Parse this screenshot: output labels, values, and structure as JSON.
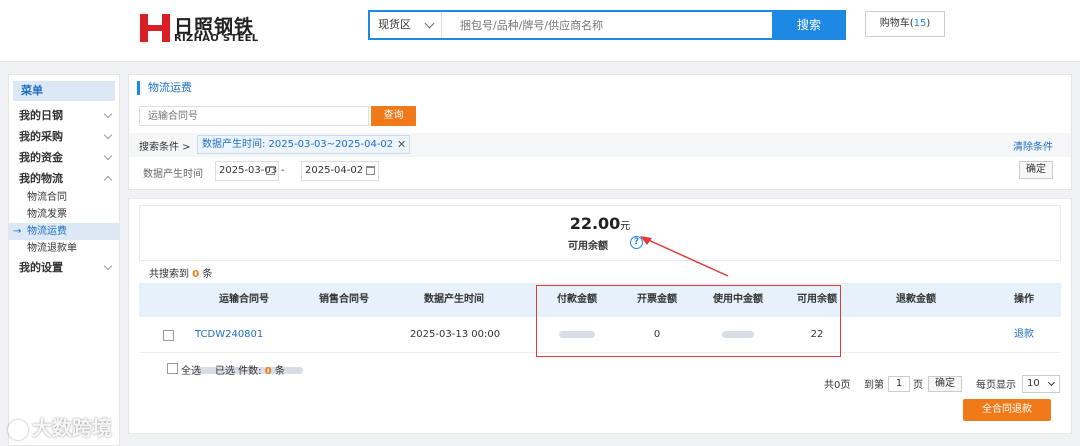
{
  "header": {
    "logo_cn": "日照钢铁",
    "logo_en": "RIZHAO STEEL",
    "search_scope": "现货区",
    "search_placeholder": "捆包号/品种/牌号/供应商名称",
    "search_button": "搜索",
    "cart_label": "购物车(",
    "cart_count": "15",
    "cart_suffix": ")"
  },
  "sidebar": {
    "title": "菜单",
    "groups": [
      {
        "label": "我的日钢"
      },
      {
        "label": "我的采购"
      },
      {
        "label": "我的资金"
      },
      {
        "label": "我的物流"
      }
    ],
    "sub_items": [
      {
        "label": "物流合同"
      },
      {
        "label": "物流发票"
      },
      {
        "label": "物流运费"
      },
      {
        "label": "物流退款单"
      }
    ],
    "last_group": "我的设置",
    "active_marker": "→"
  },
  "main": {
    "page_title": "物流运费",
    "contract_placeholder": "运输合同号",
    "query_button": "查询",
    "condition_label": "搜索条件 >",
    "condition_tag": "数据产生时间: 2025-03-03~2025-04-02",
    "condition_close": "✕",
    "clear_conditions": "清除条件",
    "date_label": "数据产生时间",
    "date_start": "2025-03-03",
    "date_end": "2025-04-02",
    "date_dash": "-",
    "confirm_button": "确定"
  },
  "balance": {
    "amount": "22.00",
    "unit": "元",
    "label": "可用余额",
    "help": "?"
  },
  "results": {
    "prefix": "共搜索到",
    "count": "0",
    "suffix": "条"
  },
  "table": {
    "headers": [
      "运输合同号",
      "销售合同号",
      "数据产生时间",
      "付款金额",
      "开票金额",
      "使用中金额",
      "可用余额",
      "退款金额",
      "操作"
    ],
    "row": {
      "transport_contract": "TCDW240801",
      "data_time": "2025-03-13 00:00",
      "invoice_amount": "0",
      "available_balance": "22",
      "action": "退款"
    }
  },
  "footer": {
    "select_all": "全选",
    "selected_prefix": "已选 件数:",
    "selected_count": "0",
    "selected_suffix": "条",
    "total_pages": "共0页",
    "goto_prefix": "到第",
    "goto_value": "1",
    "goto_suffix": "页",
    "goto_confirm": "确定",
    "per_page_label": "每页显示",
    "per_page_value": "10",
    "refund_all": "全合同退款"
  },
  "watermark": "大数跨境",
  "colors": {
    "accent": "#1e88e5",
    "orange": "#f07a1a",
    "highlight": "#e03a3a",
    "logo_red": "#d81f26"
  }
}
